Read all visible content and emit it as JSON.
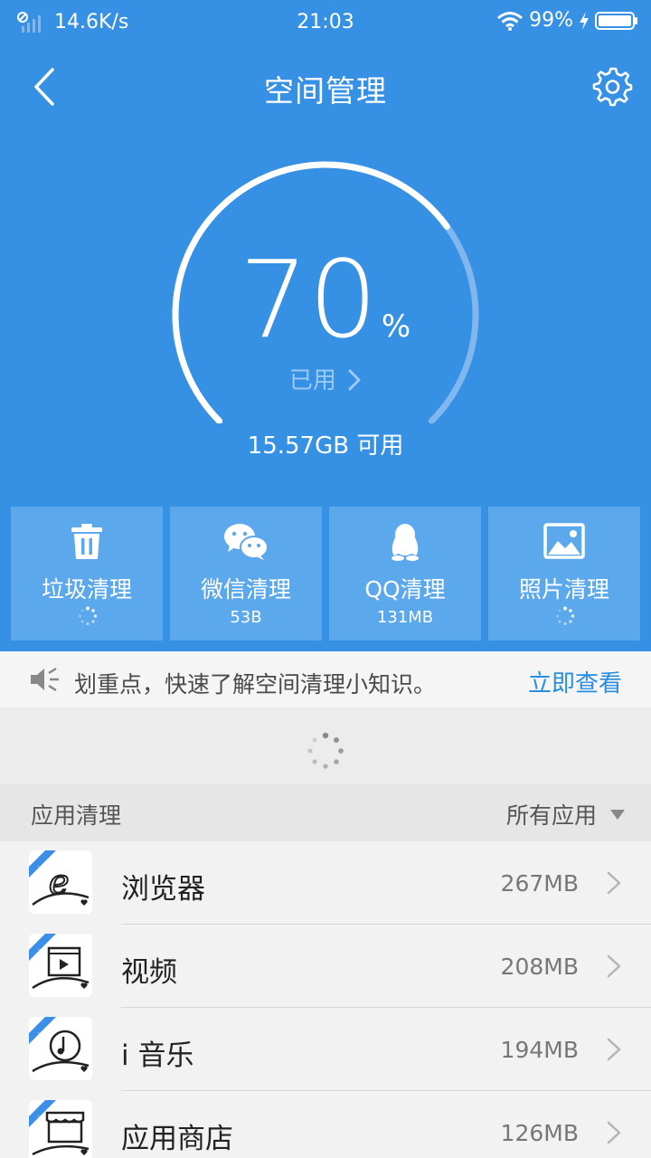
{
  "status_bar": {
    "network_speed": "14.6K/s",
    "time": "21:03",
    "battery": "99%"
  },
  "header": {
    "title": "空间管理"
  },
  "storage": {
    "used_percent": "70",
    "percent_sign": "%",
    "used_label": "已用",
    "available": "15.57GB 可用",
    "gauge_fraction": 0.7
  },
  "tiles": [
    {
      "label": "垃圾清理",
      "sub": "",
      "icon": "trash-icon"
    },
    {
      "label": "微信清理",
      "sub": "53B",
      "icon": "wechat-icon"
    },
    {
      "label": "QQ清理",
      "sub": "131MB",
      "icon": "qq-penguin-icon"
    },
    {
      "label": "照片清理",
      "sub": "",
      "icon": "photo-icon"
    }
  ],
  "tip": {
    "text": "划重点，快速了解空间清理小知识。",
    "link": "立即查看"
  },
  "apps_section": {
    "title": "应用清理",
    "filter": "所有应用"
  },
  "apps": [
    {
      "name": "浏览器",
      "size": "267MB"
    },
    {
      "name": "视频",
      "size": "208MB"
    },
    {
      "name": "i 音乐",
      "size": "194MB"
    },
    {
      "name": "应用商店",
      "size": "126MB"
    }
  ],
  "colors": {
    "primary": "#3690e3",
    "tile": "#5ba8ec",
    "link": "#2a8ee0"
  }
}
